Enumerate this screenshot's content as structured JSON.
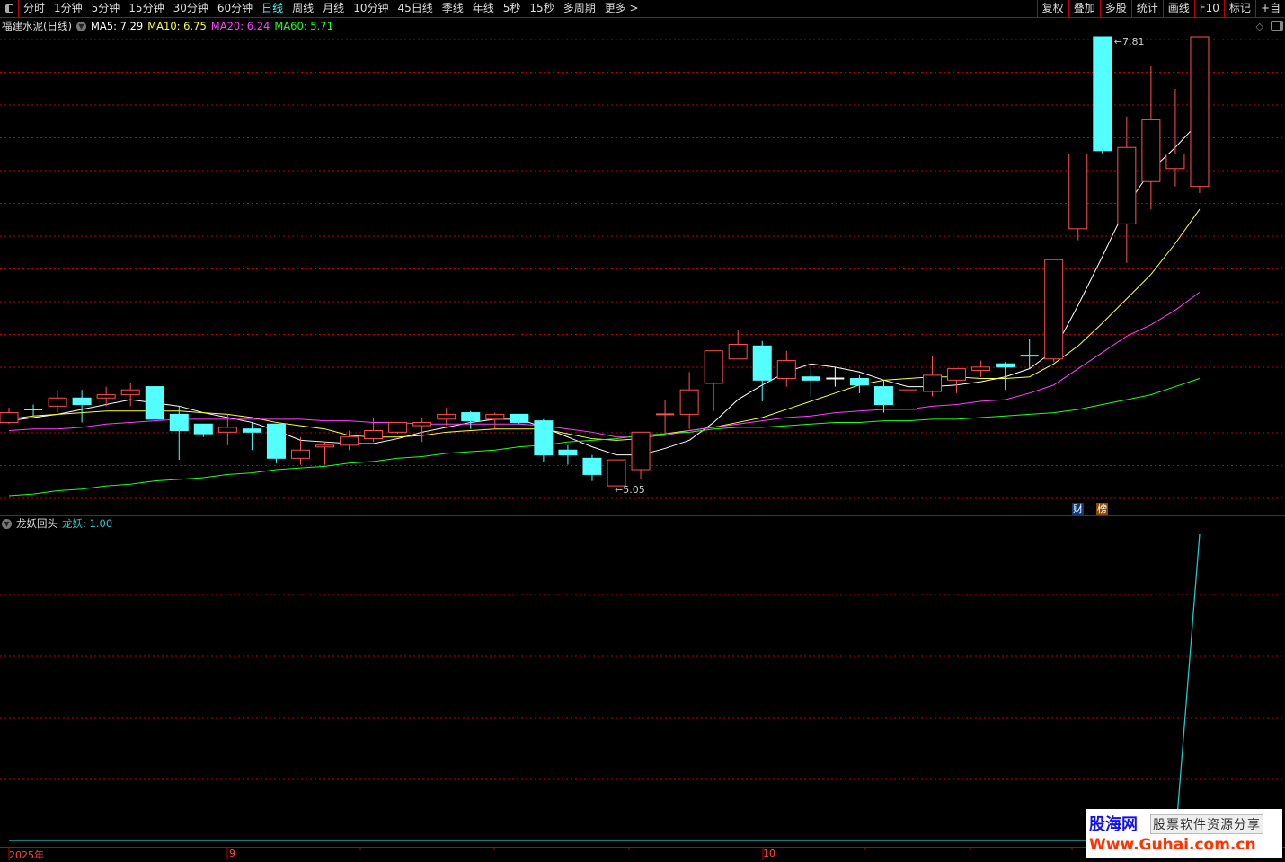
{
  "toolbar": {
    "periods": [
      "分时",
      "1分钟",
      "5分钟",
      "15分钟",
      "30分钟",
      "60分钟",
      "日线",
      "周线",
      "月线",
      "10分钟",
      "45日线",
      "季线",
      "年线",
      "5秒",
      "15秒",
      "多周期",
      "更多 >"
    ],
    "active_period": "日线",
    "right_buttons": [
      "复权",
      "叠加",
      "多股",
      "统计",
      "画线",
      "F10",
      "标记",
      "+自"
    ]
  },
  "info": {
    "stock": "福建水泥(日线)",
    "ma5_label": "MA5: 7.29",
    "ma10_label": "MA10: 6.75",
    "ma20_label": "MA20: 6.24",
    "ma60_label": "MA60: 5.71"
  },
  "colors": {
    "up": "#ff5050",
    "down": "#54ffff",
    "ma5": "#ffffff",
    "ma10": "#ffff40",
    "ma20": "#ff40ff",
    "ma60": "#20ff20",
    "grid": "#c00000",
    "indicator": "#20c8c8"
  },
  "badges": {
    "cai": "财",
    "bang": "榜"
  },
  "indicator": {
    "name": "龙妖回头",
    "value_label": "龙妖: 1.00"
  },
  "xaxis": {
    "labels": [
      "2025年",
      "9",
      "10"
    ]
  },
  "watermark": {
    "brand": "股海网",
    "slogan": "股票软件资源分享",
    "url": "Www.Guhai.com.cn"
  },
  "chart_data": [
    {
      "type": "candlestick",
      "title": "福建水泥(日线)",
      "ylim": [
        5.0,
        7.85
      ],
      "annotations": {
        "high": "7.81",
        "low": "5.05"
      },
      "ohlc": [
        [
          5.44,
          5.53,
          5.43,
          5.5
        ],
        [
          5.52,
          5.55,
          5.48,
          5.52
        ],
        [
          5.54,
          5.63,
          5.5,
          5.59
        ],
        [
          5.59,
          5.64,
          5.44,
          5.55
        ],
        [
          5.59,
          5.66,
          5.54,
          5.61
        ],
        [
          5.61,
          5.68,
          5.54,
          5.64
        ],
        [
          5.66,
          5.66,
          5.46,
          5.46
        ],
        [
          5.49,
          5.54,
          5.21,
          5.39
        ],
        [
          5.43,
          5.43,
          5.35,
          5.37
        ],
        [
          5.38,
          5.49,
          5.3,
          5.41
        ],
        [
          5.4,
          5.44,
          5.27,
          5.38
        ],
        [
          5.43,
          5.43,
          5.19,
          5.22
        ],
        [
          5.22,
          5.35,
          5.18,
          5.27
        ],
        [
          5.29,
          5.32,
          5.18,
          5.3
        ],
        [
          5.3,
          5.39,
          5.27,
          5.35
        ],
        [
          5.34,
          5.47,
          5.32,
          5.39
        ],
        [
          5.38,
          5.44,
          5.37,
          5.44
        ],
        [
          5.42,
          5.47,
          5.32,
          5.44
        ],
        [
          5.46,
          5.53,
          5.42,
          5.49
        ],
        [
          5.5,
          5.51,
          5.4,
          5.45
        ],
        [
          5.46,
          5.5,
          5.4,
          5.49
        ],
        [
          5.49,
          5.49,
          5.43,
          5.44
        ],
        [
          5.45,
          5.46,
          5.2,
          5.24
        ],
        [
          5.27,
          5.3,
          5.18,
          5.24
        ],
        [
          5.22,
          5.24,
          5.08,
          5.12
        ],
        [
          5.05,
          5.21,
          5.05,
          5.21
        ],
        [
          5.15,
          5.38,
          5.09,
          5.38
        ],
        [
          5.49,
          5.58,
          5.37,
          5.49
        ],
        [
          5.49,
          5.75,
          5.4,
          5.64
        ],
        [
          5.68,
          5.88,
          5.51,
          5.88
        ],
        [
          5.83,
          6.01,
          5.83,
          5.92
        ],
        [
          5.91,
          5.94,
          5.57,
          5.7
        ],
        [
          5.71,
          5.88,
          5.66,
          5.82
        ],
        [
          5.72,
          5.77,
          5.6,
          5.7
        ],
        [
          5.71,
          5.78,
          5.66,
          5.71
        ],
        [
          5.71,
          5.73,
          5.62,
          5.67
        ],
        [
          5.66,
          5.7,
          5.5,
          5.55
        ],
        [
          5.52,
          5.88,
          5.5,
          5.64
        ],
        [
          5.63,
          5.85,
          5.6,
          5.73
        ],
        [
          5.7,
          5.77,
          5.62,
          5.77
        ],
        [
          5.76,
          5.82,
          5.72,
          5.78
        ],
        [
          5.8,
          5.81,
          5.64,
          5.78
        ],
        [
          5.85,
          5.95,
          5.77,
          5.85
        ],
        [
          5.83,
          6.44,
          5.81,
          6.44
        ],
        [
          6.63,
          7.09,
          6.56,
          7.09
        ],
        [
          7.81,
          7.81,
          7.09,
          7.11
        ],
        [
          6.66,
          7.32,
          6.42,
          7.13
        ],
        [
          6.92,
          7.63,
          6.75,
          7.3
        ],
        [
          7.0,
          7.49,
          6.89,
          7.09
        ],
        [
          6.89,
          7.81,
          6.85,
          7.81
        ]
      ],
      "series": [
        {
          "name": "MA5",
          "values": [
            5.45,
            5.47,
            5.49,
            5.52,
            5.55,
            5.58,
            5.56,
            5.54,
            5.5,
            5.47,
            5.44,
            5.39,
            5.33,
            5.32,
            5.31,
            5.31,
            5.34,
            5.38,
            5.41,
            5.44,
            5.46,
            5.46,
            5.41,
            5.35,
            5.29,
            5.24,
            5.24,
            5.28,
            5.33,
            5.44,
            5.58,
            5.67,
            5.75,
            5.8,
            5.78,
            5.75,
            5.7,
            5.66,
            5.66,
            5.67,
            5.69,
            5.72,
            5.77,
            5.88,
            6.16,
            6.46,
            6.77,
            6.99,
            7.13,
            7.29
          ]
        },
        {
          "name": "MA10",
          "values": [
            5.46,
            5.48,
            5.49,
            5.5,
            5.51,
            5.51,
            5.51,
            5.51,
            5.5,
            5.49,
            5.47,
            5.44,
            5.42,
            5.4,
            5.36,
            5.35,
            5.35,
            5.36,
            5.38,
            5.39,
            5.4,
            5.4,
            5.4,
            5.37,
            5.34,
            5.33,
            5.34,
            5.37,
            5.39,
            5.41,
            5.44,
            5.47,
            5.52,
            5.57,
            5.62,
            5.67,
            5.7,
            5.71,
            5.72,
            5.72,
            5.71,
            5.71,
            5.72,
            5.8,
            5.91,
            6.05,
            6.2,
            6.35,
            6.54,
            6.75
          ]
        },
        {
          "name": "MA20",
          "values": [
            5.39,
            5.4,
            5.4,
            5.41,
            5.43,
            5.44,
            5.45,
            5.46,
            5.46,
            5.46,
            5.46,
            5.46,
            5.46,
            5.45,
            5.45,
            5.44,
            5.44,
            5.43,
            5.43,
            5.43,
            5.43,
            5.43,
            5.42,
            5.4,
            5.38,
            5.35,
            5.35,
            5.36,
            5.39,
            5.41,
            5.43,
            5.45,
            5.47,
            5.48,
            5.5,
            5.51,
            5.52,
            5.52,
            5.54,
            5.55,
            5.57,
            5.58,
            5.62,
            5.67,
            5.77,
            5.87,
            5.97,
            6.04,
            6.13,
            6.24
          ]
        },
        {
          "name": "MA60",
          "values": [
            4.99,
            5.0,
            5.02,
            5.03,
            5.05,
            5.06,
            5.08,
            5.09,
            5.1,
            5.12,
            5.13,
            5.15,
            5.16,
            5.17,
            5.19,
            5.2,
            5.22,
            5.23,
            5.25,
            5.26,
            5.27,
            5.29,
            5.3,
            5.32,
            5.33,
            5.34,
            5.36,
            5.37,
            5.38,
            5.4,
            5.41,
            5.41,
            5.42,
            5.43,
            5.44,
            5.44,
            5.45,
            5.45,
            5.46,
            5.46,
            5.47,
            5.48,
            5.49,
            5.5,
            5.52,
            5.55,
            5.58,
            5.61,
            5.66,
            5.71
          ]
        }
      ]
    },
    {
      "type": "line",
      "title": "龙妖回头",
      "ylim": [
        0,
        1
      ],
      "series": [
        {
          "name": "龙妖",
          "values": [
            0,
            0,
            0,
            0,
            0,
            0,
            0,
            0,
            0,
            0,
            0,
            0,
            0,
            0,
            0,
            0,
            0,
            0,
            0,
            0,
            0,
            0,
            0,
            0,
            0,
            0,
            0,
            0,
            0,
            0,
            0,
            0,
            0,
            0,
            0,
            0,
            0,
            0,
            0,
            0,
            0,
            0,
            0,
            0,
            0,
            0,
            0,
            0,
            0,
            1
          ]
        }
      ]
    }
  ]
}
